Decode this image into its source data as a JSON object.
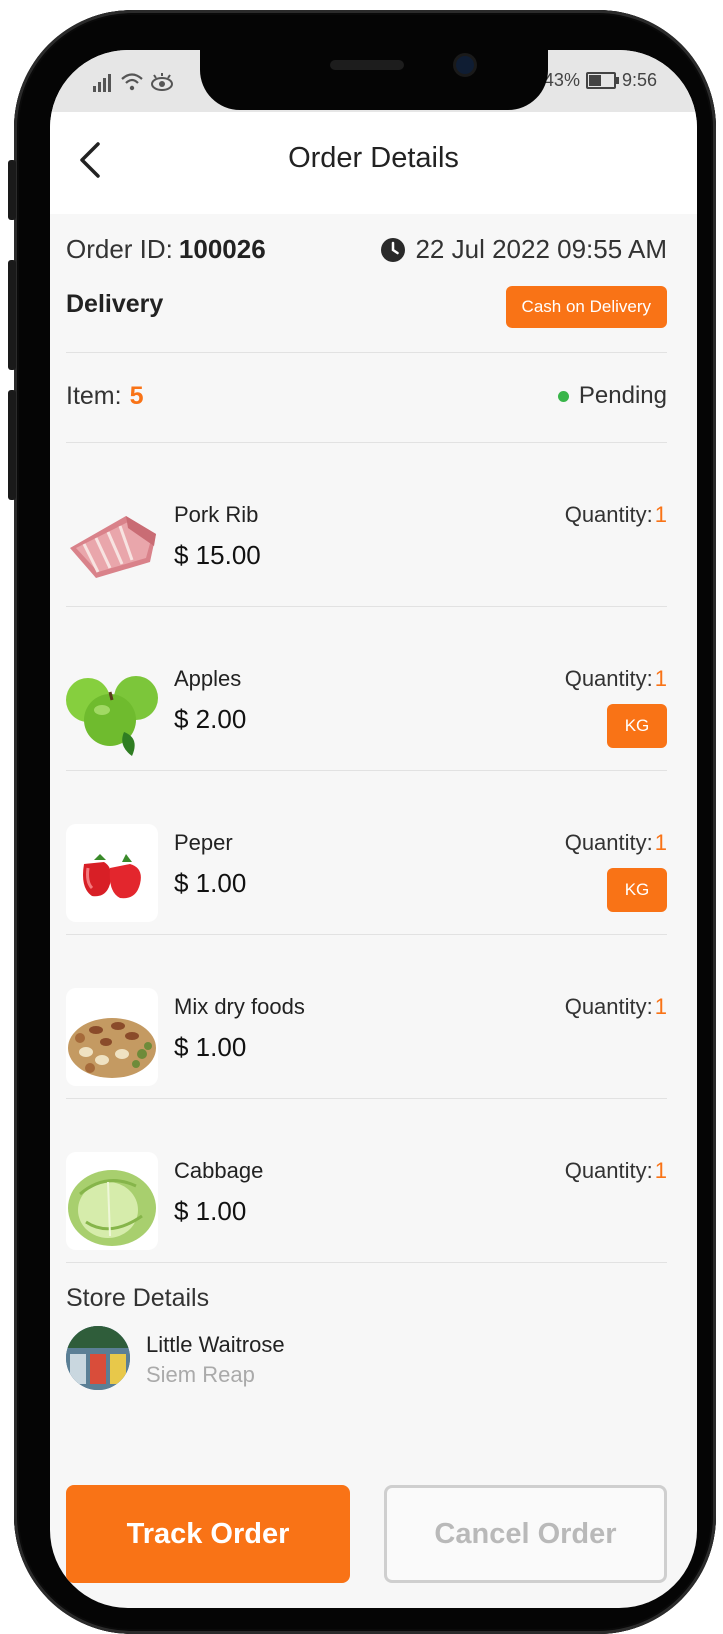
{
  "statusbar": {
    "battery_text": "43%",
    "time": "9:56"
  },
  "header": {
    "title": "Order Details"
  },
  "order": {
    "id_label": "Order ID:",
    "id_value": "100026",
    "date": "22 Jul 2022 09:55 AM",
    "type": "Delivery",
    "payment_method": "Cash on Delivery",
    "item_label": "Item:",
    "item_count": "5",
    "status": "Pending"
  },
  "items": [
    {
      "name": "Pork Rib",
      "price": "$ 15.00",
      "qty_label": "Quantity:",
      "qty": "1",
      "unit": ""
    },
    {
      "name": "Apples",
      "price": "$ 2.00",
      "qty_label": "Quantity:",
      "qty": "1",
      "unit": "KG"
    },
    {
      "name": "Peper",
      "price": "$ 1.00",
      "qty_label": "Quantity:",
      "qty": "1",
      "unit": "KG"
    },
    {
      "name": "Mix dry foods",
      "price": "$ 1.00",
      "qty_label": "Quantity:",
      "qty": "1",
      "unit": ""
    },
    {
      "name": "Cabbage",
      "price": "$ 1.00",
      "qty_label": "Quantity:",
      "qty": "1",
      "unit": ""
    }
  ],
  "store": {
    "section_title": "Store Details",
    "name": "Little Waitrose",
    "city": "Siem Reap"
  },
  "actions": {
    "track_label": "Track Order",
    "cancel_label": "Cancel Order"
  },
  "colors": {
    "accent": "#f97316",
    "status_green": "#39b54a"
  }
}
